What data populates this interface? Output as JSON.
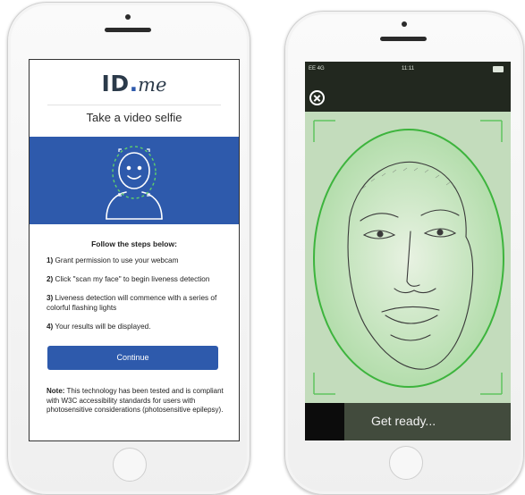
{
  "left_phone": {
    "logo": {
      "id_text": "ID",
      "dot_text": ".",
      "me_text": "me"
    },
    "title": "Take a video selfie",
    "steps_heading": "Follow the steps below:",
    "steps": [
      {
        "num": "1)",
        "text": " Grant permission to use your webcam"
      },
      {
        "num": "2)",
        "text": " Click \"scan my face\" to begin liveness detection"
      },
      {
        "num": "3)",
        "text": " Liveness detection will commence with a series of colorful flashing lights"
      },
      {
        "num": "4)",
        "text": " Your results will be displayed."
      }
    ],
    "continue_label": "Continue",
    "note_label": "Note:",
    "note_text": " This technology has been tested and is compliant with W3C accessibility standards for users with photosensitive considerations (photosensitive epilepsy)."
  },
  "right_phone": {
    "status_carrier": "EE 4G",
    "status_time": "11:11",
    "ready_text": "Get ready..."
  },
  "colors": {
    "brand_blue": "#2e5aac",
    "oval_green": "#3db43d",
    "overlay_dark": "#22281f"
  }
}
